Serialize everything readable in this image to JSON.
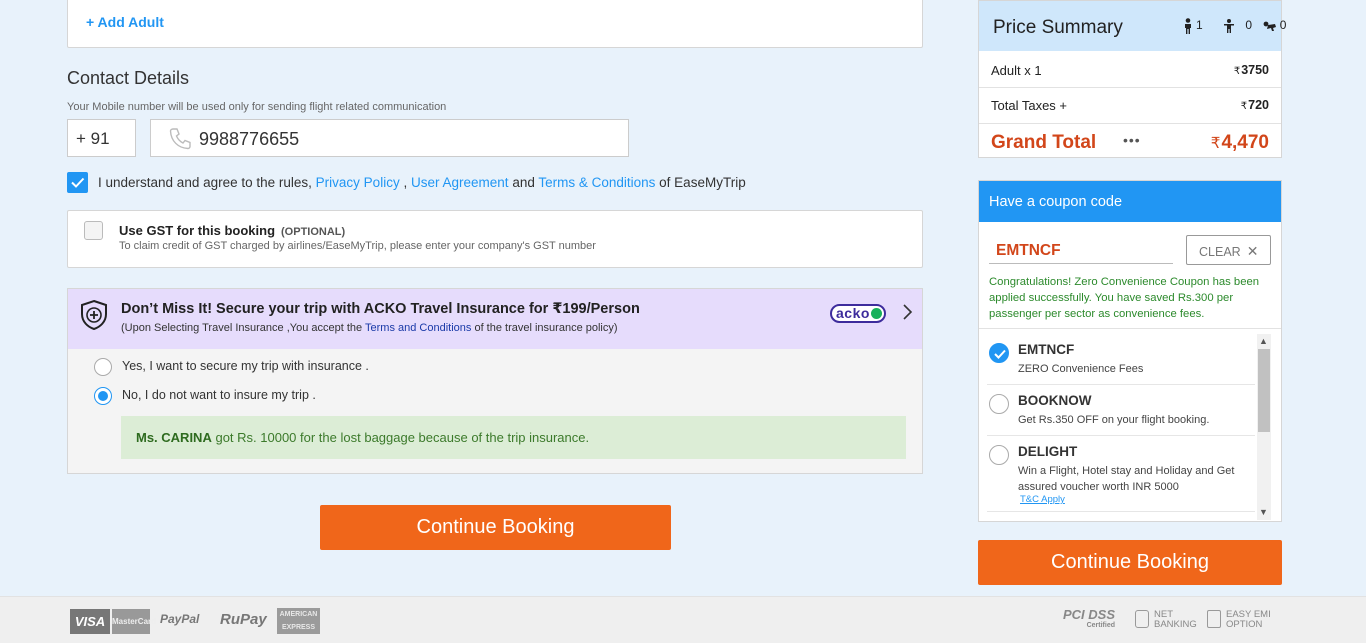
{
  "traveller": {
    "add_adult_label": "+ Add Adult"
  },
  "contact": {
    "title": "Contact Details",
    "subtitle": "Your Mobile number will be used only for sending flight related communication",
    "country_code": "+ 91",
    "mobile_value": "9988776655"
  },
  "agreement": {
    "checked": true,
    "prefix": "I understand and agree to the rules,",
    "privacy_policy": "Privacy Policy",
    "comma": ",",
    "user_agreement": "User Agreement",
    "and": "and",
    "terms": "Terms & Conditions",
    "suffix": "of EaseMyTrip"
  },
  "gst": {
    "title": "Use GST for this booking",
    "optional": "(OPTIONAL)",
    "subtitle": "To claim credit of GST charged by airlines/EaseMyTrip, please enter your company's GST number"
  },
  "insurance": {
    "title": "Don’t Miss It! Secure your trip with ACKO Travel Insurance for",
    "price": "₹199/Person",
    "sub_prefix": "(Upon Selecting Travel Insurance ,You accept the",
    "sub_link": "Terms and Conditions",
    "sub_suffix": "of the travel insurance policy)",
    "brand": "acko",
    "option_yes": "Yes, I want to secure my trip with insurance .",
    "option_no": "No, I do not want to insure my trip .",
    "selected": "no",
    "banner_name": "Ms. CARINA",
    "banner_text": "got Rs. 10000 for the lost baggage because of the trip insurance."
  },
  "continue_label": "Continue Booking",
  "price_summary": {
    "title": "Price Summary",
    "adults": "1",
    "children": "0",
    "infants": "0",
    "rows": [
      {
        "label": "Adult x 1",
        "value": "3750"
      },
      {
        "label": "Total Taxes +",
        "value": "720"
      }
    ],
    "grand_total_label": "Grand Total",
    "grand_total_dots": "•••",
    "grand_total_value": "4,470",
    "currency_symbol": "₹"
  },
  "coupon": {
    "title": "Have a coupon code",
    "input_value": "EMTNCF",
    "clear_label": "CLEAR",
    "success_message": "Congratulations! Zero Convenience Coupon has been applied successfully. You have saved Rs.300 per passenger per sector as convenience fees.",
    "items": [
      {
        "code": "EMTNCF",
        "desc": "ZERO Convenience Fees",
        "selected": true
      },
      {
        "code": "BOOKNOW",
        "desc": "Get Rs.350 OFF on your flight booking.",
        "selected": false
      },
      {
        "code": "DELIGHT",
        "desc": "Win a Flight, Hotel stay and Holiday and Get assured voucher worth INR 5000",
        "selected": false,
        "link": "T&C Apply"
      }
    ]
  },
  "footer": {
    "payments": [
      "VISA",
      "MasterCard",
      "PayPal",
      "RuPay",
      "AMERICAN EXPRESS"
    ],
    "pci": "PCI DSS",
    "pci_sub": "Certified",
    "net_banking": "NET BANKING",
    "easy_emi": "EASY EMI OPTION"
  },
  "colors": {
    "accent_blue": "#2196f3",
    "cta_orange": "#f0661a",
    "total_red": "#d2461a"
  }
}
